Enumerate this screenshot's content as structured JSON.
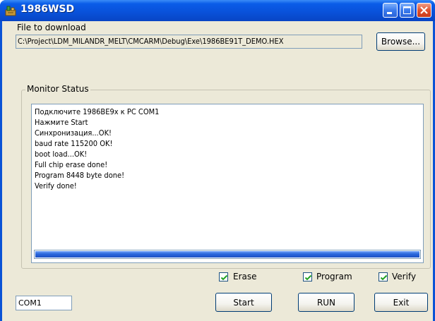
{
  "window": {
    "title": "1986WSD"
  },
  "file_section": {
    "label": "File to download",
    "path": "C:\\Project\\LDM_MILANDR_MELT\\CMCARM\\Debug\\Exe\\1986BE91T_DEMO.HEX",
    "browse_label": "Browse..."
  },
  "monitor": {
    "group_title": "Monitor Status",
    "lines": [
      "Подключите 1986BE9x к PC COM1",
      "Нажмите Start",
      "Синхронизация...OK!",
      "baud rate 115200 OK!",
      "boot load...OK!",
      "Full chip erase done!",
      "Program 8448 byte done!",
      "Verify done!"
    ],
    "progress_fraction": 1.0
  },
  "options": {
    "erase": {
      "label": "Erase",
      "checked": true
    },
    "program": {
      "label": "Program",
      "checked": true
    },
    "verify": {
      "label": "Verify",
      "checked": true
    }
  },
  "bottom": {
    "port_value": "COM1",
    "start_label": "Start",
    "run_label": "RUN",
    "exit_label": "Exit"
  },
  "icons": {
    "app": "app-icon",
    "minimize": "minimize-icon",
    "maximize": "maximize-icon",
    "close": "close-icon",
    "check": "check-icon"
  },
  "colors": {
    "titlebar": "#0a52d9",
    "client_bg": "#ece9d8",
    "progress": "#2a67dc",
    "close_button": "#e0532f"
  }
}
